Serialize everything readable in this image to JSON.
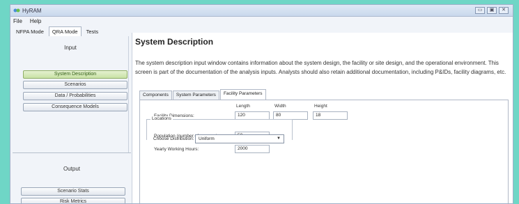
{
  "window": {
    "title": "HyRAM",
    "controls": {
      "minimize": "▭",
      "maximize": "▣",
      "close": "✕"
    }
  },
  "menu": [
    "File",
    "Help"
  ],
  "mode_tabs": [
    "NFPA Mode",
    "QRA Mode",
    "Tests"
  ],
  "mode_active_index": 1,
  "left_panel": {
    "input_label": "Input",
    "input_buttons": [
      "System Description",
      "Scenarios",
      "Data / Probabilities",
      "Consequence Models"
    ],
    "active_button_index": 0,
    "output_label": "Output",
    "output_buttons": [
      "Scenario Stats",
      "Risk Metrics"
    ]
  },
  "main": {
    "title": "System Description",
    "description": "The system description input window contains information about the system design, the facility or site design, and the operational environment. This screen is part of the documentation of the analysis inputs. Analysts should also retain additional documentation, including P&IDs, facility diagrams, etc.",
    "tabs": [
      "Components",
      "System Parameters",
      "Facility Parameters"
    ],
    "active_tab_index": 2,
    "facility": {
      "dimensions_label": "Facility Dimensions:",
      "length_label": "Length",
      "width_label": "Width",
      "height_label": "Height",
      "length_value": "120",
      "width_value": "80",
      "height_value": "18",
      "population_label": "Population (number of persons)",
      "population_value": "50",
      "working_hours_label": "Yearly Working Hours:",
      "working_hours_value": "2000",
      "locations_label": "Locations",
      "distribution_label": "Choose Distribution:",
      "distribution_value": "Uniform"
    }
  },
  "colors": {
    "active_button": "#c9e2a6",
    "background": "#6fd6c6"
  }
}
